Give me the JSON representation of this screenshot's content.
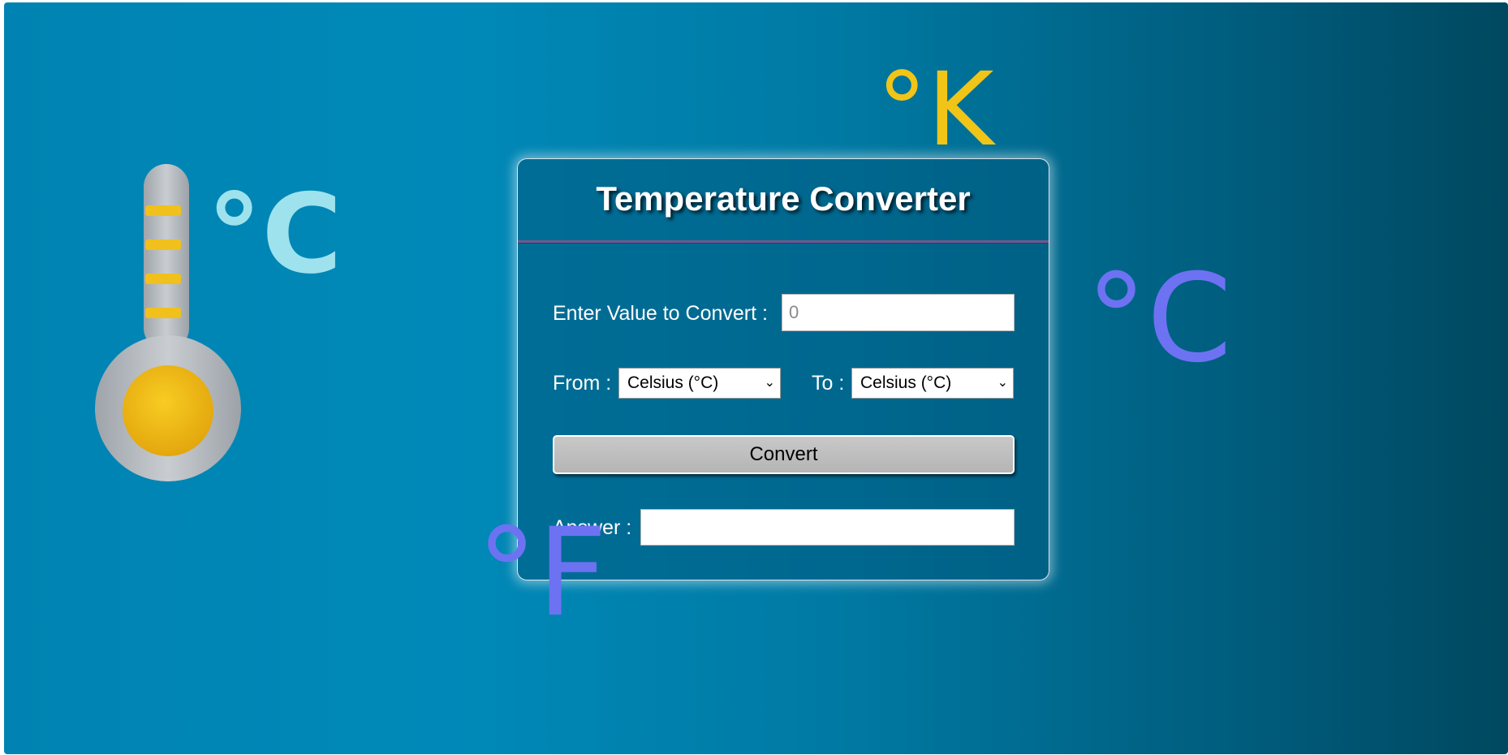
{
  "decorations": {
    "kelvin_symbol": "°K",
    "celsius_symbol_left": "°C",
    "celsius_symbol_right": "°C",
    "fahrenheit_symbol": "°F",
    "thermometer_icon": "thermometer-icon"
  },
  "converter": {
    "title": "Temperature Converter",
    "value_label": "Enter Value to Convert :",
    "value_placeholder": "0",
    "value_current": "",
    "from_label": "From :",
    "from_selected": "Celsius (°C)",
    "to_label": "To :",
    "to_selected": "Celsius (°C)",
    "convert_label": "Convert",
    "answer_label": "Answer :",
    "answer_value": ""
  },
  "colors": {
    "background_start": "#0083b2",
    "background_end": "#004860",
    "kelvin": "#f1c418",
    "celsius_left": "#9ee2ee",
    "celsius_right": "#6d72f2",
    "fahrenheit": "#6d72f2",
    "thermometer_bulb": "#f0b914"
  }
}
